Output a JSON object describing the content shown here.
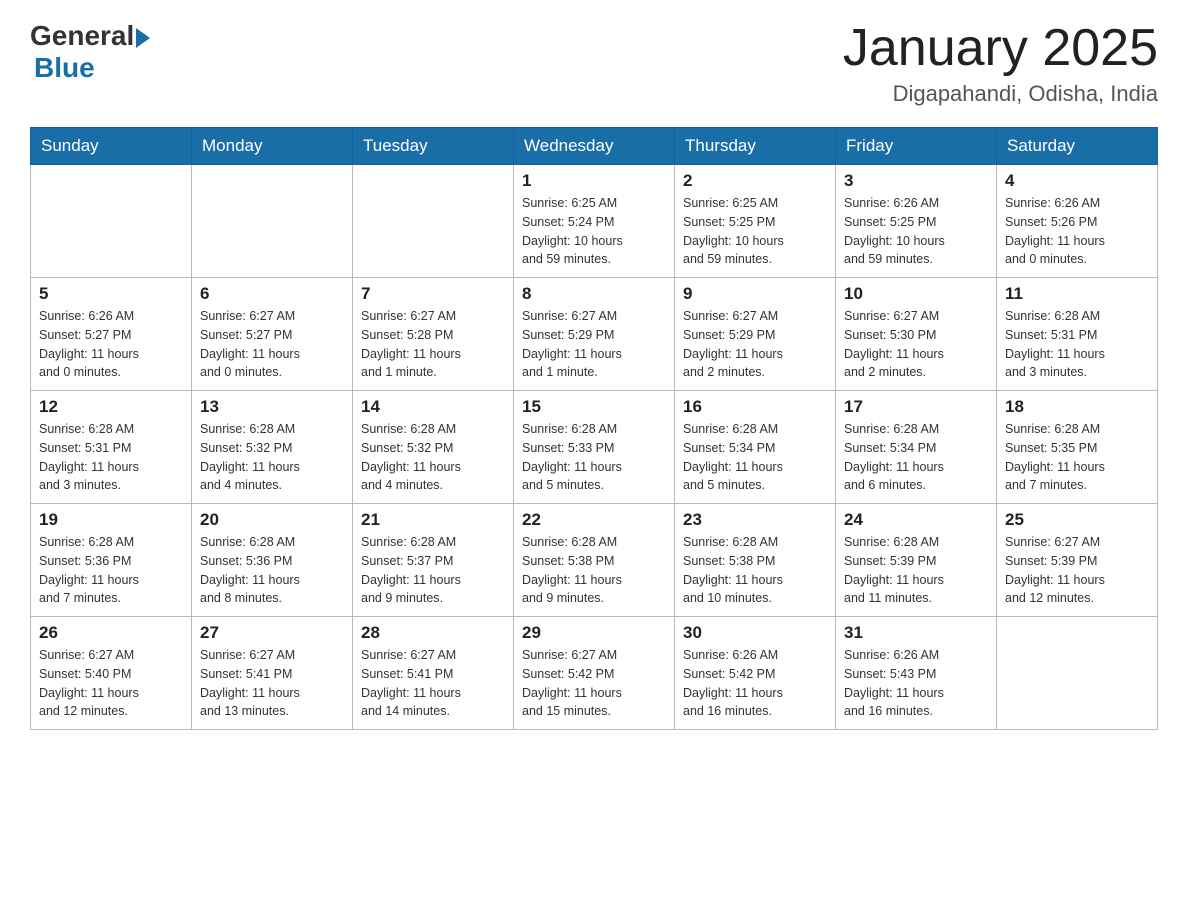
{
  "logo": {
    "general": "General",
    "blue": "Blue"
  },
  "title": "January 2025",
  "location": "Digapahandi, Odisha, India",
  "weekdays": [
    "Sunday",
    "Monday",
    "Tuesday",
    "Wednesday",
    "Thursday",
    "Friday",
    "Saturday"
  ],
  "weeks": [
    [
      {
        "day": "",
        "info": ""
      },
      {
        "day": "",
        "info": ""
      },
      {
        "day": "",
        "info": ""
      },
      {
        "day": "1",
        "info": "Sunrise: 6:25 AM\nSunset: 5:24 PM\nDaylight: 10 hours\nand 59 minutes."
      },
      {
        "day": "2",
        "info": "Sunrise: 6:25 AM\nSunset: 5:25 PM\nDaylight: 10 hours\nand 59 minutes."
      },
      {
        "day": "3",
        "info": "Sunrise: 6:26 AM\nSunset: 5:25 PM\nDaylight: 10 hours\nand 59 minutes."
      },
      {
        "day": "4",
        "info": "Sunrise: 6:26 AM\nSunset: 5:26 PM\nDaylight: 11 hours\nand 0 minutes."
      }
    ],
    [
      {
        "day": "5",
        "info": "Sunrise: 6:26 AM\nSunset: 5:27 PM\nDaylight: 11 hours\nand 0 minutes."
      },
      {
        "day": "6",
        "info": "Sunrise: 6:27 AM\nSunset: 5:27 PM\nDaylight: 11 hours\nand 0 minutes."
      },
      {
        "day": "7",
        "info": "Sunrise: 6:27 AM\nSunset: 5:28 PM\nDaylight: 11 hours\nand 1 minute."
      },
      {
        "day": "8",
        "info": "Sunrise: 6:27 AM\nSunset: 5:29 PM\nDaylight: 11 hours\nand 1 minute."
      },
      {
        "day": "9",
        "info": "Sunrise: 6:27 AM\nSunset: 5:29 PM\nDaylight: 11 hours\nand 2 minutes."
      },
      {
        "day": "10",
        "info": "Sunrise: 6:27 AM\nSunset: 5:30 PM\nDaylight: 11 hours\nand 2 minutes."
      },
      {
        "day": "11",
        "info": "Sunrise: 6:28 AM\nSunset: 5:31 PM\nDaylight: 11 hours\nand 3 minutes."
      }
    ],
    [
      {
        "day": "12",
        "info": "Sunrise: 6:28 AM\nSunset: 5:31 PM\nDaylight: 11 hours\nand 3 minutes."
      },
      {
        "day": "13",
        "info": "Sunrise: 6:28 AM\nSunset: 5:32 PM\nDaylight: 11 hours\nand 4 minutes."
      },
      {
        "day": "14",
        "info": "Sunrise: 6:28 AM\nSunset: 5:32 PM\nDaylight: 11 hours\nand 4 minutes."
      },
      {
        "day": "15",
        "info": "Sunrise: 6:28 AM\nSunset: 5:33 PM\nDaylight: 11 hours\nand 5 minutes."
      },
      {
        "day": "16",
        "info": "Sunrise: 6:28 AM\nSunset: 5:34 PM\nDaylight: 11 hours\nand 5 minutes."
      },
      {
        "day": "17",
        "info": "Sunrise: 6:28 AM\nSunset: 5:34 PM\nDaylight: 11 hours\nand 6 minutes."
      },
      {
        "day": "18",
        "info": "Sunrise: 6:28 AM\nSunset: 5:35 PM\nDaylight: 11 hours\nand 7 minutes."
      }
    ],
    [
      {
        "day": "19",
        "info": "Sunrise: 6:28 AM\nSunset: 5:36 PM\nDaylight: 11 hours\nand 7 minutes."
      },
      {
        "day": "20",
        "info": "Sunrise: 6:28 AM\nSunset: 5:36 PM\nDaylight: 11 hours\nand 8 minutes."
      },
      {
        "day": "21",
        "info": "Sunrise: 6:28 AM\nSunset: 5:37 PM\nDaylight: 11 hours\nand 9 minutes."
      },
      {
        "day": "22",
        "info": "Sunrise: 6:28 AM\nSunset: 5:38 PM\nDaylight: 11 hours\nand 9 minutes."
      },
      {
        "day": "23",
        "info": "Sunrise: 6:28 AM\nSunset: 5:38 PM\nDaylight: 11 hours\nand 10 minutes."
      },
      {
        "day": "24",
        "info": "Sunrise: 6:28 AM\nSunset: 5:39 PM\nDaylight: 11 hours\nand 11 minutes."
      },
      {
        "day": "25",
        "info": "Sunrise: 6:27 AM\nSunset: 5:39 PM\nDaylight: 11 hours\nand 12 minutes."
      }
    ],
    [
      {
        "day": "26",
        "info": "Sunrise: 6:27 AM\nSunset: 5:40 PM\nDaylight: 11 hours\nand 12 minutes."
      },
      {
        "day": "27",
        "info": "Sunrise: 6:27 AM\nSunset: 5:41 PM\nDaylight: 11 hours\nand 13 minutes."
      },
      {
        "day": "28",
        "info": "Sunrise: 6:27 AM\nSunset: 5:41 PM\nDaylight: 11 hours\nand 14 minutes."
      },
      {
        "day": "29",
        "info": "Sunrise: 6:27 AM\nSunset: 5:42 PM\nDaylight: 11 hours\nand 15 minutes."
      },
      {
        "day": "30",
        "info": "Sunrise: 6:26 AM\nSunset: 5:42 PM\nDaylight: 11 hours\nand 16 minutes."
      },
      {
        "day": "31",
        "info": "Sunrise: 6:26 AM\nSunset: 5:43 PM\nDaylight: 11 hours\nand 16 minutes."
      },
      {
        "day": "",
        "info": ""
      }
    ]
  ]
}
